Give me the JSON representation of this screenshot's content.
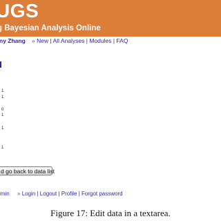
{
  "header": {
    "logo_text": "UGS",
    "tagline": "g Bayesian Analysis Online",
    "brand_color": "#dc7d38"
  },
  "navbar": {
    "user": "ny Zhang",
    "separator": "»",
    "new": "New",
    "all_analyses": "All Analyses",
    "modules": "Modules",
    "faq": "FAQ"
  },
  "data_rows": [
    "1",
    "1",
    "0",
    "1",
    "1",
    "1"
  ],
  "back_button_label": "d go back to data list",
  "footer": {
    "admin": "lmin",
    "separator": "»",
    "login": "Login",
    "logout": "Logout",
    "profile": "Profile",
    "forgot_password": "Forgot password"
  },
  "caption": "Figure 17: Edit data in a textarea."
}
